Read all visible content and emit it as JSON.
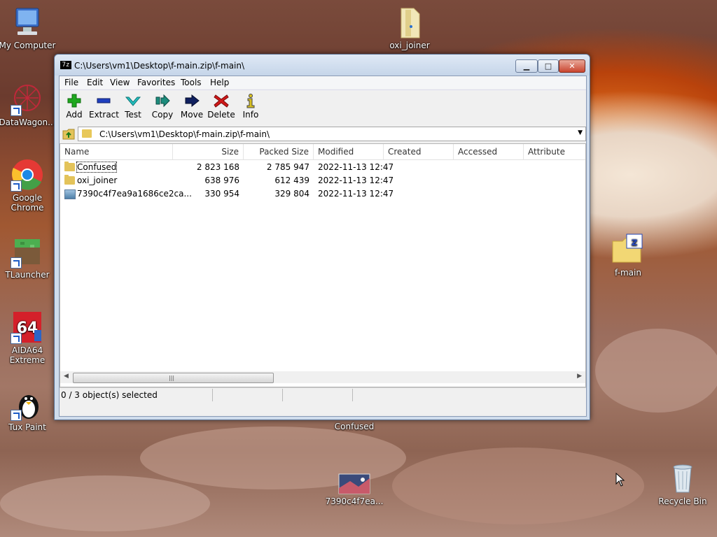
{
  "desktop": {
    "icons": [
      {
        "id": "my-computer",
        "label": "My Computer"
      },
      {
        "id": "datawagon",
        "label": "DataWagon..."
      },
      {
        "id": "chrome",
        "label": "Google Chrome"
      },
      {
        "id": "tlauncher",
        "label": "TLauncher"
      },
      {
        "id": "aida64",
        "label": "AIDA64 Extreme",
        "badge": "64"
      },
      {
        "id": "tuxpaint",
        "label": "Tux Paint"
      },
      {
        "id": "oxi-joiner",
        "label": "oxi_joiner"
      },
      {
        "id": "f-main",
        "label": "f-main"
      },
      {
        "id": "confused",
        "label": "Confused"
      },
      {
        "id": "image7390",
        "label": "7390c4f7ea..."
      },
      {
        "id": "recycle-bin",
        "label": "Recycle Bin"
      }
    ]
  },
  "window": {
    "title": "C:\\Users\\vm1\\Desktop\\f-main.zip\\f-main\\",
    "app_icon": "7z",
    "min_glyph": "▁",
    "max_glyph": "□",
    "close_glyph": "✕",
    "menu": [
      "File",
      "Edit",
      "View",
      "Favorites",
      "Tools",
      "Help"
    ],
    "toolbar": [
      {
        "label": "Add",
        "icon": "plus-icon",
        "color": "#1fa81f"
      },
      {
        "label": "Extract",
        "icon": "minus-icon",
        "color": "#1f3fbf"
      },
      {
        "label": "Test",
        "icon": "check-icon",
        "color": "#22c0c0"
      },
      {
        "label": "Copy",
        "icon": "copy-arrow-icon",
        "color": "#1c8c7c"
      },
      {
        "label": "Move",
        "icon": "move-arrow-icon",
        "color": "#10205f"
      },
      {
        "label": "Delete",
        "icon": "delete-x-icon",
        "color": "#d01818"
      },
      {
        "label": "Info",
        "icon": "info-icon",
        "color": "#d8c020"
      }
    ],
    "address": "C:\\Users\\vm1\\Desktop\\f-main.zip\\f-main\\",
    "columns": [
      "Name",
      "Size",
      "Packed Size",
      "Modified",
      "Created",
      "Accessed",
      "Attribute"
    ],
    "rows": [
      {
        "name": "Confused",
        "size": "2 823 168",
        "packed": "2 785 947",
        "modified": "2022-11-13 12:47",
        "type": "folder"
      },
      {
        "name": "oxi_joiner",
        "size": "638 976",
        "packed": "612 439",
        "modified": "2022-11-13 12:47",
        "type": "folder"
      },
      {
        "name": "7390c4f7ea9a1686ce2ca...",
        "size": "330 954",
        "packed": "329 804",
        "modified": "2022-11-13 12:47",
        "type": "image"
      }
    ],
    "status": "0 / 3 object(s) selected"
  }
}
